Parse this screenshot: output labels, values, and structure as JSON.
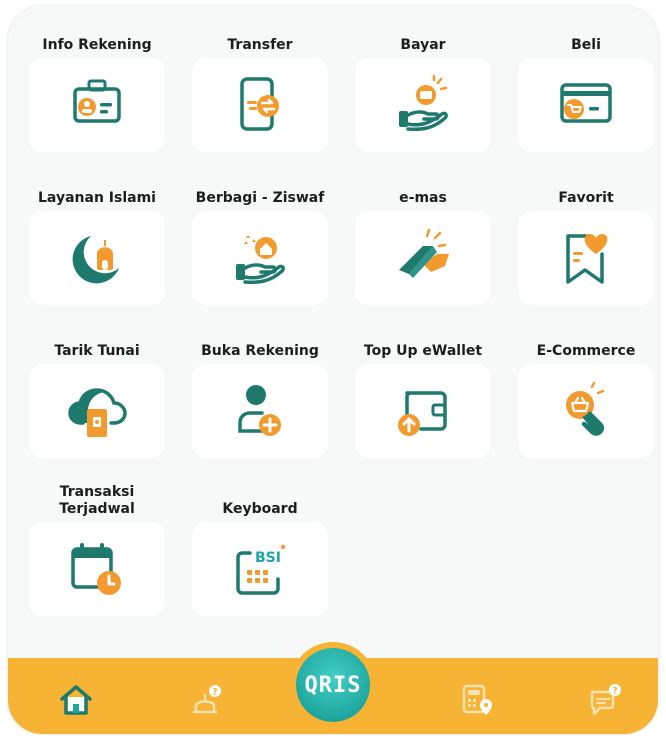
{
  "menu": {
    "items": [
      {
        "label": "Info Rekening",
        "icon": "id-card-icon"
      },
      {
        "label": "Transfer",
        "icon": "phone-transfer-icon"
      },
      {
        "label": "Bayar",
        "icon": "hand-card-icon"
      },
      {
        "label": "Beli",
        "icon": "cart-card-icon"
      },
      {
        "label": "Layanan Islami",
        "icon": "mosque-crescent-icon"
      },
      {
        "label": "Berbagi - Ziswaf",
        "icon": "hand-house-icon"
      },
      {
        "label": "e-mas",
        "icon": "gold-bar-icon"
      },
      {
        "label": "Favorit",
        "icon": "bookmark-heart-icon"
      },
      {
        "label": "Tarik Tunai",
        "icon": "cloud-atm-icon"
      },
      {
        "label": "Buka Rekening",
        "icon": "user-add-icon"
      },
      {
        "label": "Top Up eWallet",
        "icon": "wallet-topup-icon"
      },
      {
        "label": "E-Commerce",
        "icon": "basket-tap-icon"
      },
      {
        "label": "Transaksi\nTerjadwal",
        "icon": "calendar-clock-icon"
      },
      {
        "label": "Keyboard",
        "icon": "keyboard-icon",
        "badge": "BSI"
      }
    ]
  },
  "bottom_nav": {
    "items": [
      {
        "name": "home",
        "icon": "home-icon"
      },
      {
        "name": "islami",
        "icon": "mosque-icon"
      },
      {
        "name": "qris",
        "icon": "qris-icon",
        "label": "QRIS"
      },
      {
        "name": "calculator",
        "icon": "calculator-pin-icon"
      },
      {
        "name": "help",
        "icon": "chat-help-icon"
      }
    ]
  },
  "colors": {
    "teal": "#1f7a6e",
    "orange": "#f29a2e",
    "bar": "#f7b334",
    "qris": "#1ea79e"
  }
}
